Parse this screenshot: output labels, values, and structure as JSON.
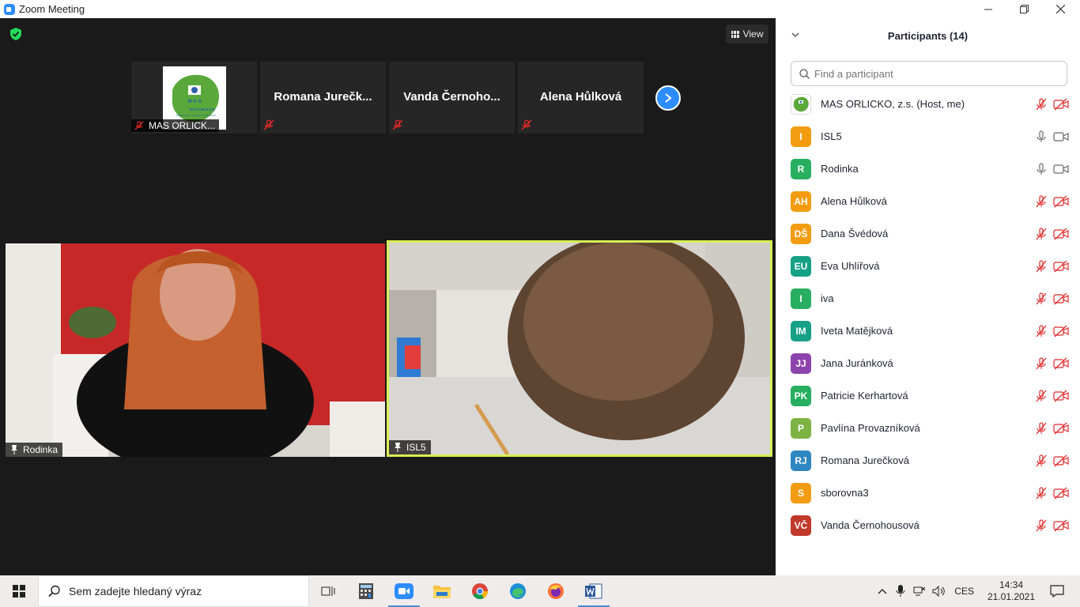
{
  "window": {
    "title": "Zoom Meeting",
    "minimize_icon": "minimize-icon",
    "maximize_icon": "restore-icon",
    "close_icon": "close-icon"
  },
  "meeting": {
    "view_label": "View",
    "thumbnails": [
      {
        "name": "MAS ORLICK...",
        "type": "logo"
      },
      {
        "name": "Romana  Jurečk...",
        "type": "name"
      },
      {
        "name": "Vanda  Černoho...",
        "type": "name"
      },
      {
        "name": "Alena Hůlková",
        "type": "name"
      }
    ],
    "logo_text": {
      "top": "M·A·S",
      "org": "MAS ORLICKO",
      "tag": "VAŠE PLÁNY + NAŠE ZKUŠENOSTI"
    },
    "videos": [
      {
        "label": "Rodinka"
      },
      {
        "label": "ISL5"
      }
    ],
    "colors": {
      "active_speaker": "#d7ef56",
      "accent": "#2d8cff",
      "mute_red": "#e02828"
    }
  },
  "participants": {
    "header": "Participants (14)",
    "search_placeholder": "Find a participant",
    "list": [
      {
        "initials": "",
        "name": "MAS ORLICKO, z.s. (Host, me)",
        "color": "#ffffff",
        "mic": "muted",
        "cam": "off",
        "avatar": "logo"
      },
      {
        "initials": "I",
        "name": "ISL5",
        "color": "#f39c12",
        "mic": "on",
        "cam": "on"
      },
      {
        "initials": "R",
        "name": "Rodinka",
        "color": "#27ae60",
        "mic": "on",
        "cam": "on"
      },
      {
        "initials": "AH",
        "name": "Alena Hůlková",
        "color": "#f39c12",
        "mic": "muted",
        "cam": "off"
      },
      {
        "initials": "DŠ",
        "name": "Dana Švédová",
        "color": "#f39c12",
        "mic": "muted",
        "cam": "off"
      },
      {
        "initials": "EU",
        "name": "Eva Uhlířová",
        "color": "#16a085",
        "mic": "muted",
        "cam": "off"
      },
      {
        "initials": "I",
        "name": "iva",
        "color": "#27ae60",
        "mic": "muted",
        "cam": "off"
      },
      {
        "initials": "IM",
        "name": "Iveta Matějková",
        "color": "#16a085",
        "mic": "muted",
        "cam": "off"
      },
      {
        "initials": "JJ",
        "name": "Jana Juránková",
        "color": "#8e44ad",
        "mic": "muted",
        "cam": "off"
      },
      {
        "initials": "PK",
        "name": "Patricie Kerhartová",
        "color": "#27ae60",
        "mic": "muted",
        "cam": "off"
      },
      {
        "initials": "P",
        "name": "Pavlína Provazníková",
        "color": "#7cb342",
        "mic": "muted",
        "cam": "off"
      },
      {
        "initials": "RJ",
        "name": "Romana Jurečková",
        "color": "#2e86c1",
        "mic": "muted",
        "cam": "off"
      },
      {
        "initials": "S",
        "name": "sborovna3",
        "color": "#f39c12",
        "mic": "muted",
        "cam": "off"
      },
      {
        "initials": "VČ",
        "name": "Vanda Černohousová",
        "color": "#c0392b",
        "mic": "muted",
        "cam": "off"
      }
    ]
  },
  "taskbar": {
    "search_placeholder": "Sem zadejte hledaný výraz",
    "apps": [
      "task-view-icon",
      "calculator-icon",
      "zoom-icon",
      "file-explorer-icon",
      "chrome-icon",
      "edge-icon",
      "firefox-icon",
      "word-icon"
    ],
    "language": "CES",
    "time": "14:34",
    "date": "21.01.2021"
  }
}
